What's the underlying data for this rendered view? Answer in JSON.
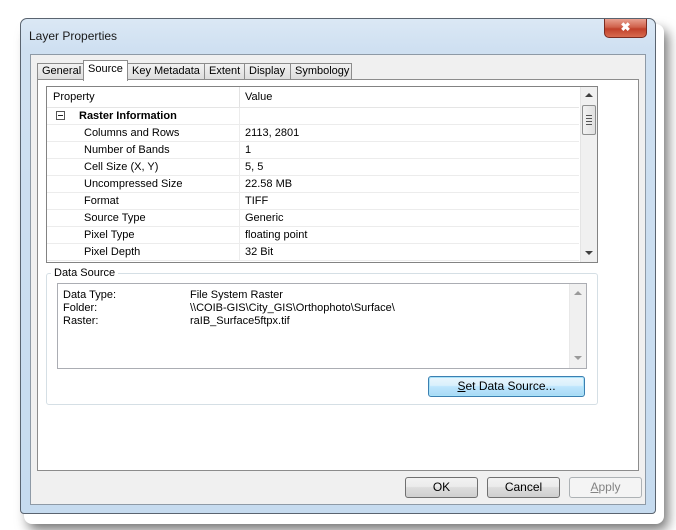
{
  "window": {
    "title": "Layer Properties",
    "close_label": "✖"
  },
  "tabs": [
    {
      "label": "General",
      "active": false
    },
    {
      "label": "Source",
      "active": true
    },
    {
      "label": "Key Metadata",
      "active": false
    },
    {
      "label": "Extent",
      "active": false
    },
    {
      "label": "Display",
      "active": false
    },
    {
      "label": "Symbology",
      "active": false
    }
  ],
  "grid": {
    "columns": [
      "Property",
      "Value"
    ],
    "group": {
      "label": "Raster Information",
      "expanded": true,
      "expander_glyph": "minus-box"
    },
    "rows": [
      {
        "property": "Columns and Rows",
        "value": "2113, 2801"
      },
      {
        "property": "Number of Bands",
        "value": "1"
      },
      {
        "property": "Cell Size (X, Y)",
        "value": "5, 5"
      },
      {
        "property": "Uncompressed Size",
        "value": "22.58 MB"
      },
      {
        "property": "Format",
        "value": "TIFF"
      },
      {
        "property": "Source Type",
        "value": "Generic"
      },
      {
        "property": "Pixel Type",
        "value": "floating point"
      },
      {
        "property": "Pixel Depth",
        "value": "32 Bit"
      }
    ]
  },
  "data_source": {
    "title": "Data Source",
    "lines": [
      {
        "key": "Data Type:",
        "value": "File System Raster"
      },
      {
        "key": "Folder:",
        "value": "\\\\COIB-GIS\\City_GIS\\Orthophoto\\Surface\\"
      },
      {
        "key": "Raster:",
        "value": "raIB_Surface5ftpx.tif"
      }
    ],
    "set_button": {
      "mnemonic": "S",
      "rest": "et Data Source..."
    }
  },
  "buttons": {
    "ok": "OK",
    "cancel": "Cancel",
    "apply_mnemonic": "A",
    "apply_rest": "pply",
    "apply_enabled": false
  }
}
